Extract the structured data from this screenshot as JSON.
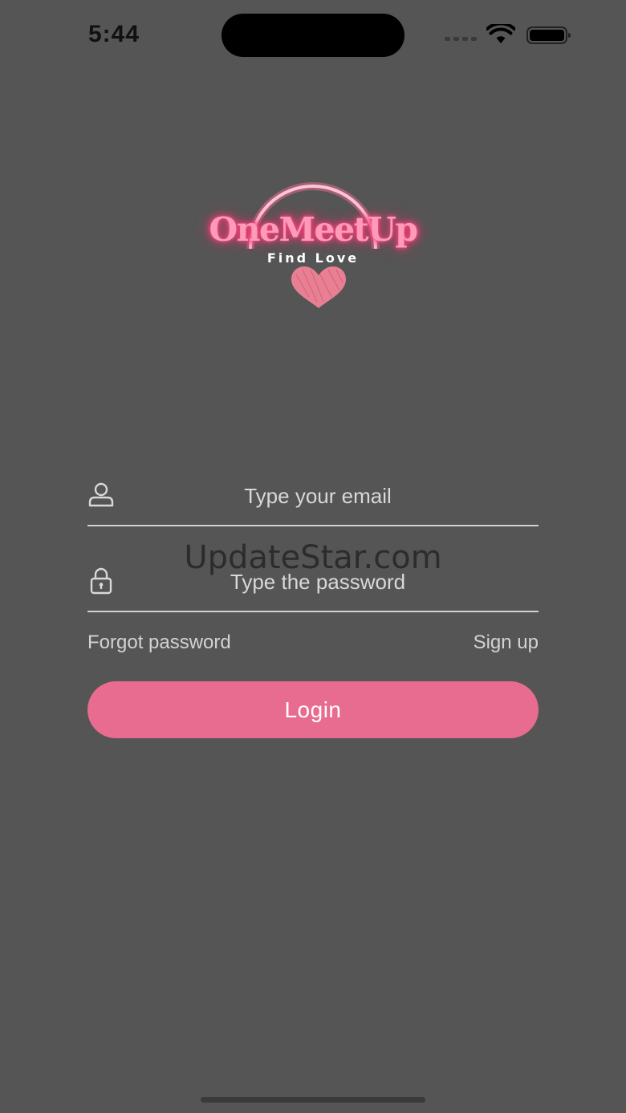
{
  "status_bar": {
    "time": "5:44"
  },
  "logo": {
    "title": "OneMeetUp",
    "tagline": "Find Love",
    "accent_color": "#ff3d7a"
  },
  "form": {
    "email_placeholder": "Type your email",
    "password_placeholder": "Type the password",
    "forgot_password_label": "Forgot password",
    "sign_up_label": "Sign up",
    "login_label": "Login",
    "login_button_color": "#e86b90"
  },
  "watermark": "UpdateStar.com",
  "icons": {
    "email_field": "user-icon",
    "password_field": "lock-icon",
    "status": [
      "signal-icon",
      "wifi-icon",
      "battery-icon"
    ]
  }
}
